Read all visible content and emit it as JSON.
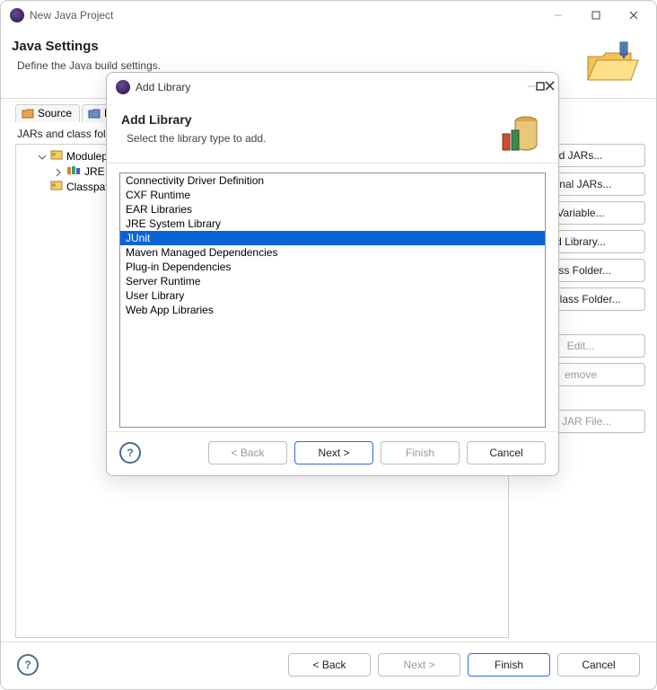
{
  "main_window": {
    "title": "New Java Project",
    "header": {
      "title": "Java Settings",
      "subtitle": "Define the Java build settings."
    },
    "tabs": [
      {
        "label": "Source"
      },
      {
        "label": "Pr"
      }
    ],
    "jars_label": "JARs and class fol",
    "tree": {
      "modulepath": "Modulepa",
      "jre": "JRE Syst",
      "classpath": "Classpath"
    },
    "side_buttons": {
      "add_jars": "d JARs...",
      "add_external_jars": "ernal JARs...",
      "add_variable": "Variable...",
      "add_library": "d Library...",
      "add_class_folder": "lass Folder...",
      "add_ext_class_folder": "al Class Folder...",
      "edit": "Edit...",
      "remove": "emove",
      "migrate": "te JAR File..."
    },
    "footer": {
      "back": "< Back",
      "next": "Next >",
      "finish": "Finish",
      "cancel": "Cancel"
    }
  },
  "dialog": {
    "title": "Add Library",
    "header": {
      "title": "Add Library",
      "subtitle": "Select the library type to add."
    },
    "items": [
      "Connectivity Driver Definition",
      "CXF Runtime",
      "EAR Libraries",
      "JRE System Library",
      "JUnit",
      "Maven Managed Dependencies",
      "Plug-in Dependencies",
      "Server Runtime",
      "User Library",
      "Web App Libraries"
    ],
    "selected_index": 4,
    "footer": {
      "back": "< Back",
      "next": "Next >",
      "finish": "Finish",
      "cancel": "Cancel"
    }
  }
}
